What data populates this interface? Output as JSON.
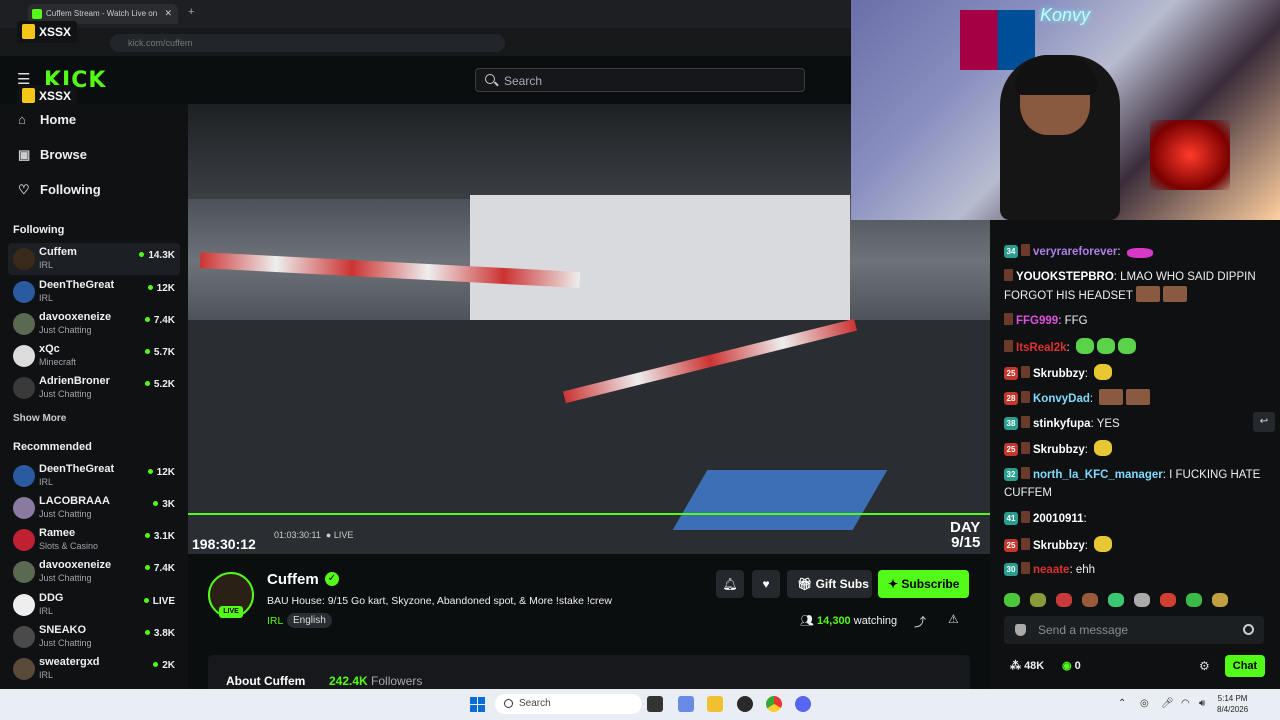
{
  "browser": {
    "tab_title": "Cuffem Stream - Watch Live on",
    "url": "kick.com/cuffem"
  },
  "header": {
    "logo": "KICK",
    "search_placeholder": "Search",
    "overlay_badge": "XSSX"
  },
  "sidebar": {
    "nav": [
      {
        "label": "Home",
        "icon": "home-icon"
      },
      {
        "label": "Browse",
        "icon": "compass-icon"
      },
      {
        "label": "Following",
        "icon": "heart-icon"
      }
    ],
    "following_title": "Following",
    "following": [
      {
        "name": "Cuffem",
        "category": "IRL",
        "viewers": "14.3K"
      },
      {
        "name": "DeenTheGreat",
        "category": "IRL",
        "viewers": "12K"
      },
      {
        "name": "davooxeneize",
        "category": "Just Chatting",
        "viewers": "7.4K"
      },
      {
        "name": "xQc",
        "category": "Minecraft",
        "viewers": "5.7K"
      },
      {
        "name": "AdrienBroner",
        "category": "Just Chatting",
        "viewers": "5.2K"
      }
    ],
    "show_more": "Show More",
    "recommended_title": "Recommended",
    "recommended": [
      {
        "name": "DeenTheGreat",
        "category": "IRL",
        "viewers": "12K"
      },
      {
        "name": "LACOBRAAA",
        "category": "Just Chatting",
        "viewers": "3K"
      },
      {
        "name": "Ramee",
        "category": "Slots & Casino",
        "viewers": "3.1K"
      },
      {
        "name": "davooxeneize",
        "category": "Just Chatting",
        "viewers": "7.4K"
      },
      {
        "name": "DDG",
        "category": "IRL",
        "viewers": "LIVE"
      },
      {
        "name": "SNEAKO",
        "category": "Just Chatting",
        "viewers": "3.8K"
      },
      {
        "name": "sweatergxd",
        "category": "IRL",
        "viewers": "2K"
      }
    ]
  },
  "video": {
    "elapsed": "198:30:12",
    "sub_time": "01:03:30:11",
    "live_label": "LIVE",
    "day_label": "DAY",
    "day_value": "9/15",
    "webcam_sign": "Konvy"
  },
  "stream": {
    "streamer": "Cuffem",
    "live_badge": "LIVE",
    "title": "BAU House: 9/15 Go kart, Skyzone, Abandoned spot, & More !stake !crew",
    "category": "IRL",
    "language": "English",
    "gift_label": "Gift Subs",
    "subscribe_label": "Subscribe",
    "watching_count": "14,300",
    "watching_label": "watching",
    "about_label": "About Cuffem",
    "followers_count": "242.4K",
    "followers_label": "Followers"
  },
  "chat": {
    "messages": [
      {
        "level": "34",
        "user": "veryrareforever",
        "text": "",
        "color": "#b07fe8",
        "emote": "pink"
      },
      {
        "level": "",
        "user": "YOUOKSTEPBRO",
        "text": "LMAO WHO SAID DIPPIN FORGOT HIS HEADSET",
        "color": "#ffffff",
        "emote": "face"
      },
      {
        "level": "",
        "user": "FFG999",
        "text": "FFG",
        "color": "#e050e0",
        "emote": ""
      },
      {
        "level": "",
        "user": "ItsReal2k",
        "text": "",
        "color": "#e03030",
        "emote": "green"
      },
      {
        "level": "25",
        "user": "Skrubbzy",
        "text": "",
        "color": "#ffffff",
        "emote": "yel"
      },
      {
        "level": "28",
        "user": "KonvyDad",
        "text": "",
        "color": "#7fdcff",
        "emote": "face"
      },
      {
        "level": "38",
        "user": "stinkyfupa",
        "text": "YES",
        "color": "#ffffff",
        "emote": ""
      },
      {
        "level": "25",
        "user": "Skrubbzy",
        "text": "",
        "color": "#ffffff",
        "emote": "yel"
      },
      {
        "level": "32",
        "user": "north_la_KFC_manager",
        "text": "I FUCKING HATE CUFFEM",
        "color": "#7fdcff",
        "emote": ""
      },
      {
        "level": "41",
        "user": "20010911",
        "text": "",
        "color": "#ffffff",
        "emote": ""
      },
      {
        "level": "25",
        "user": "Skrubbzy",
        "text": "",
        "color": "#ffffff",
        "emote": "yel"
      },
      {
        "level": "30",
        "user": "neaate",
        "text": "ehh",
        "color": "#e03030",
        "emote": ""
      }
    ],
    "input_placeholder": "Send a message",
    "viewers_stat": "48K",
    "points_stat": "0",
    "chat_button": "Chat"
  },
  "taskbar": {
    "search_placeholder": "Search",
    "time": "5:14 PM",
    "date": "8/4/2026"
  },
  "colors": {
    "accent": "#53fc18",
    "background": "#0b0e0f"
  }
}
